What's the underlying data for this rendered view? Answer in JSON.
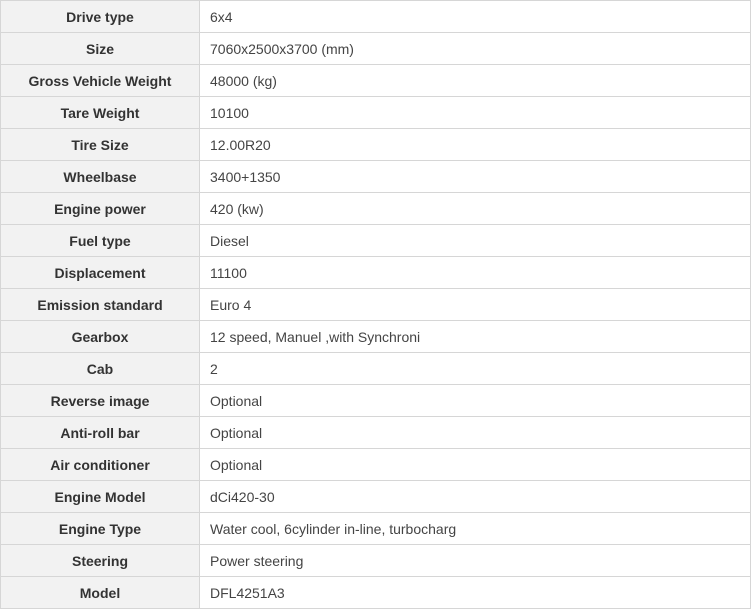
{
  "spec_table": {
    "rows": [
      {
        "label": "Drive type",
        "value": "6x4"
      },
      {
        "label": "Size",
        "value": "7060x2500x3700 (mm)"
      },
      {
        "label": "Gross Vehicle Weight",
        "value": "48000 (kg)"
      },
      {
        "label": "Tare Weight",
        "value": "10100"
      },
      {
        "label": "Tire Size",
        "value": "12.00R20"
      },
      {
        "label": "Wheelbase",
        "value": "3400+1350"
      },
      {
        "label": "Engine power",
        "value": "420 (kw)"
      },
      {
        "label": "Fuel type",
        "value": "Diesel"
      },
      {
        "label": "Displacement",
        "value": "11100"
      },
      {
        "label": "Emission standard",
        "value": "Euro 4"
      },
      {
        "label": "Gearbox",
        "value": "12 speed, Manuel ,with Synchroni"
      },
      {
        "label": "Cab",
        "value": "2"
      },
      {
        "label": "Reverse image",
        "value": "Optional"
      },
      {
        "label": "Anti-roll bar",
        "value": "Optional"
      },
      {
        "label": "Air conditioner",
        "value": "Optional"
      },
      {
        "label": "Engine Model",
        "value": "dCi420-30"
      },
      {
        "label": "Engine Type",
        "value": "Water cool, 6cylinder in-line, turbocharg"
      },
      {
        "label": "Steering",
        "value": "Power steering"
      },
      {
        "label": "Model",
        "value": "DFL4251A3"
      }
    ]
  }
}
